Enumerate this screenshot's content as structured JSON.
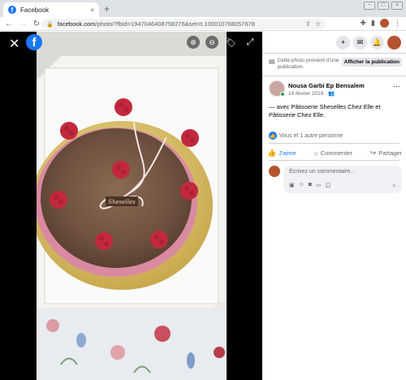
{
  "browser": {
    "tab_title": "Facebook",
    "tab_close": "×",
    "new_tab": "+",
    "url_host": "facebook.com",
    "url_rest": "/photo/?fbid=1947046408758276&set=t.100010768057678",
    "window_controls": [
      "−",
      "□",
      "×"
    ]
  },
  "viewer": {
    "close_label": "✕",
    "logo": "f",
    "cake_text": "Sheselles"
  },
  "panel": {
    "source_text": "Cette photo provient d'une publication.",
    "source_button": "Afficher la publication",
    "author": "Nousa Garbi Ep Bensalem",
    "date": "14 février 2019 · ",
    "post_text": "— avec Pâtisserie Sheselles Chez Elle et Pâtisserie Chez Elle.",
    "reaction_text": "Vous et 1 autre personne",
    "actions": {
      "like": "J'aime",
      "comment": "Commenter",
      "share": "Partager"
    },
    "comment_placeholder": "Écrivez un commentaire..."
  },
  "colors": {
    "brand": "#1877f2",
    "viewer_bg": "#000000"
  }
}
